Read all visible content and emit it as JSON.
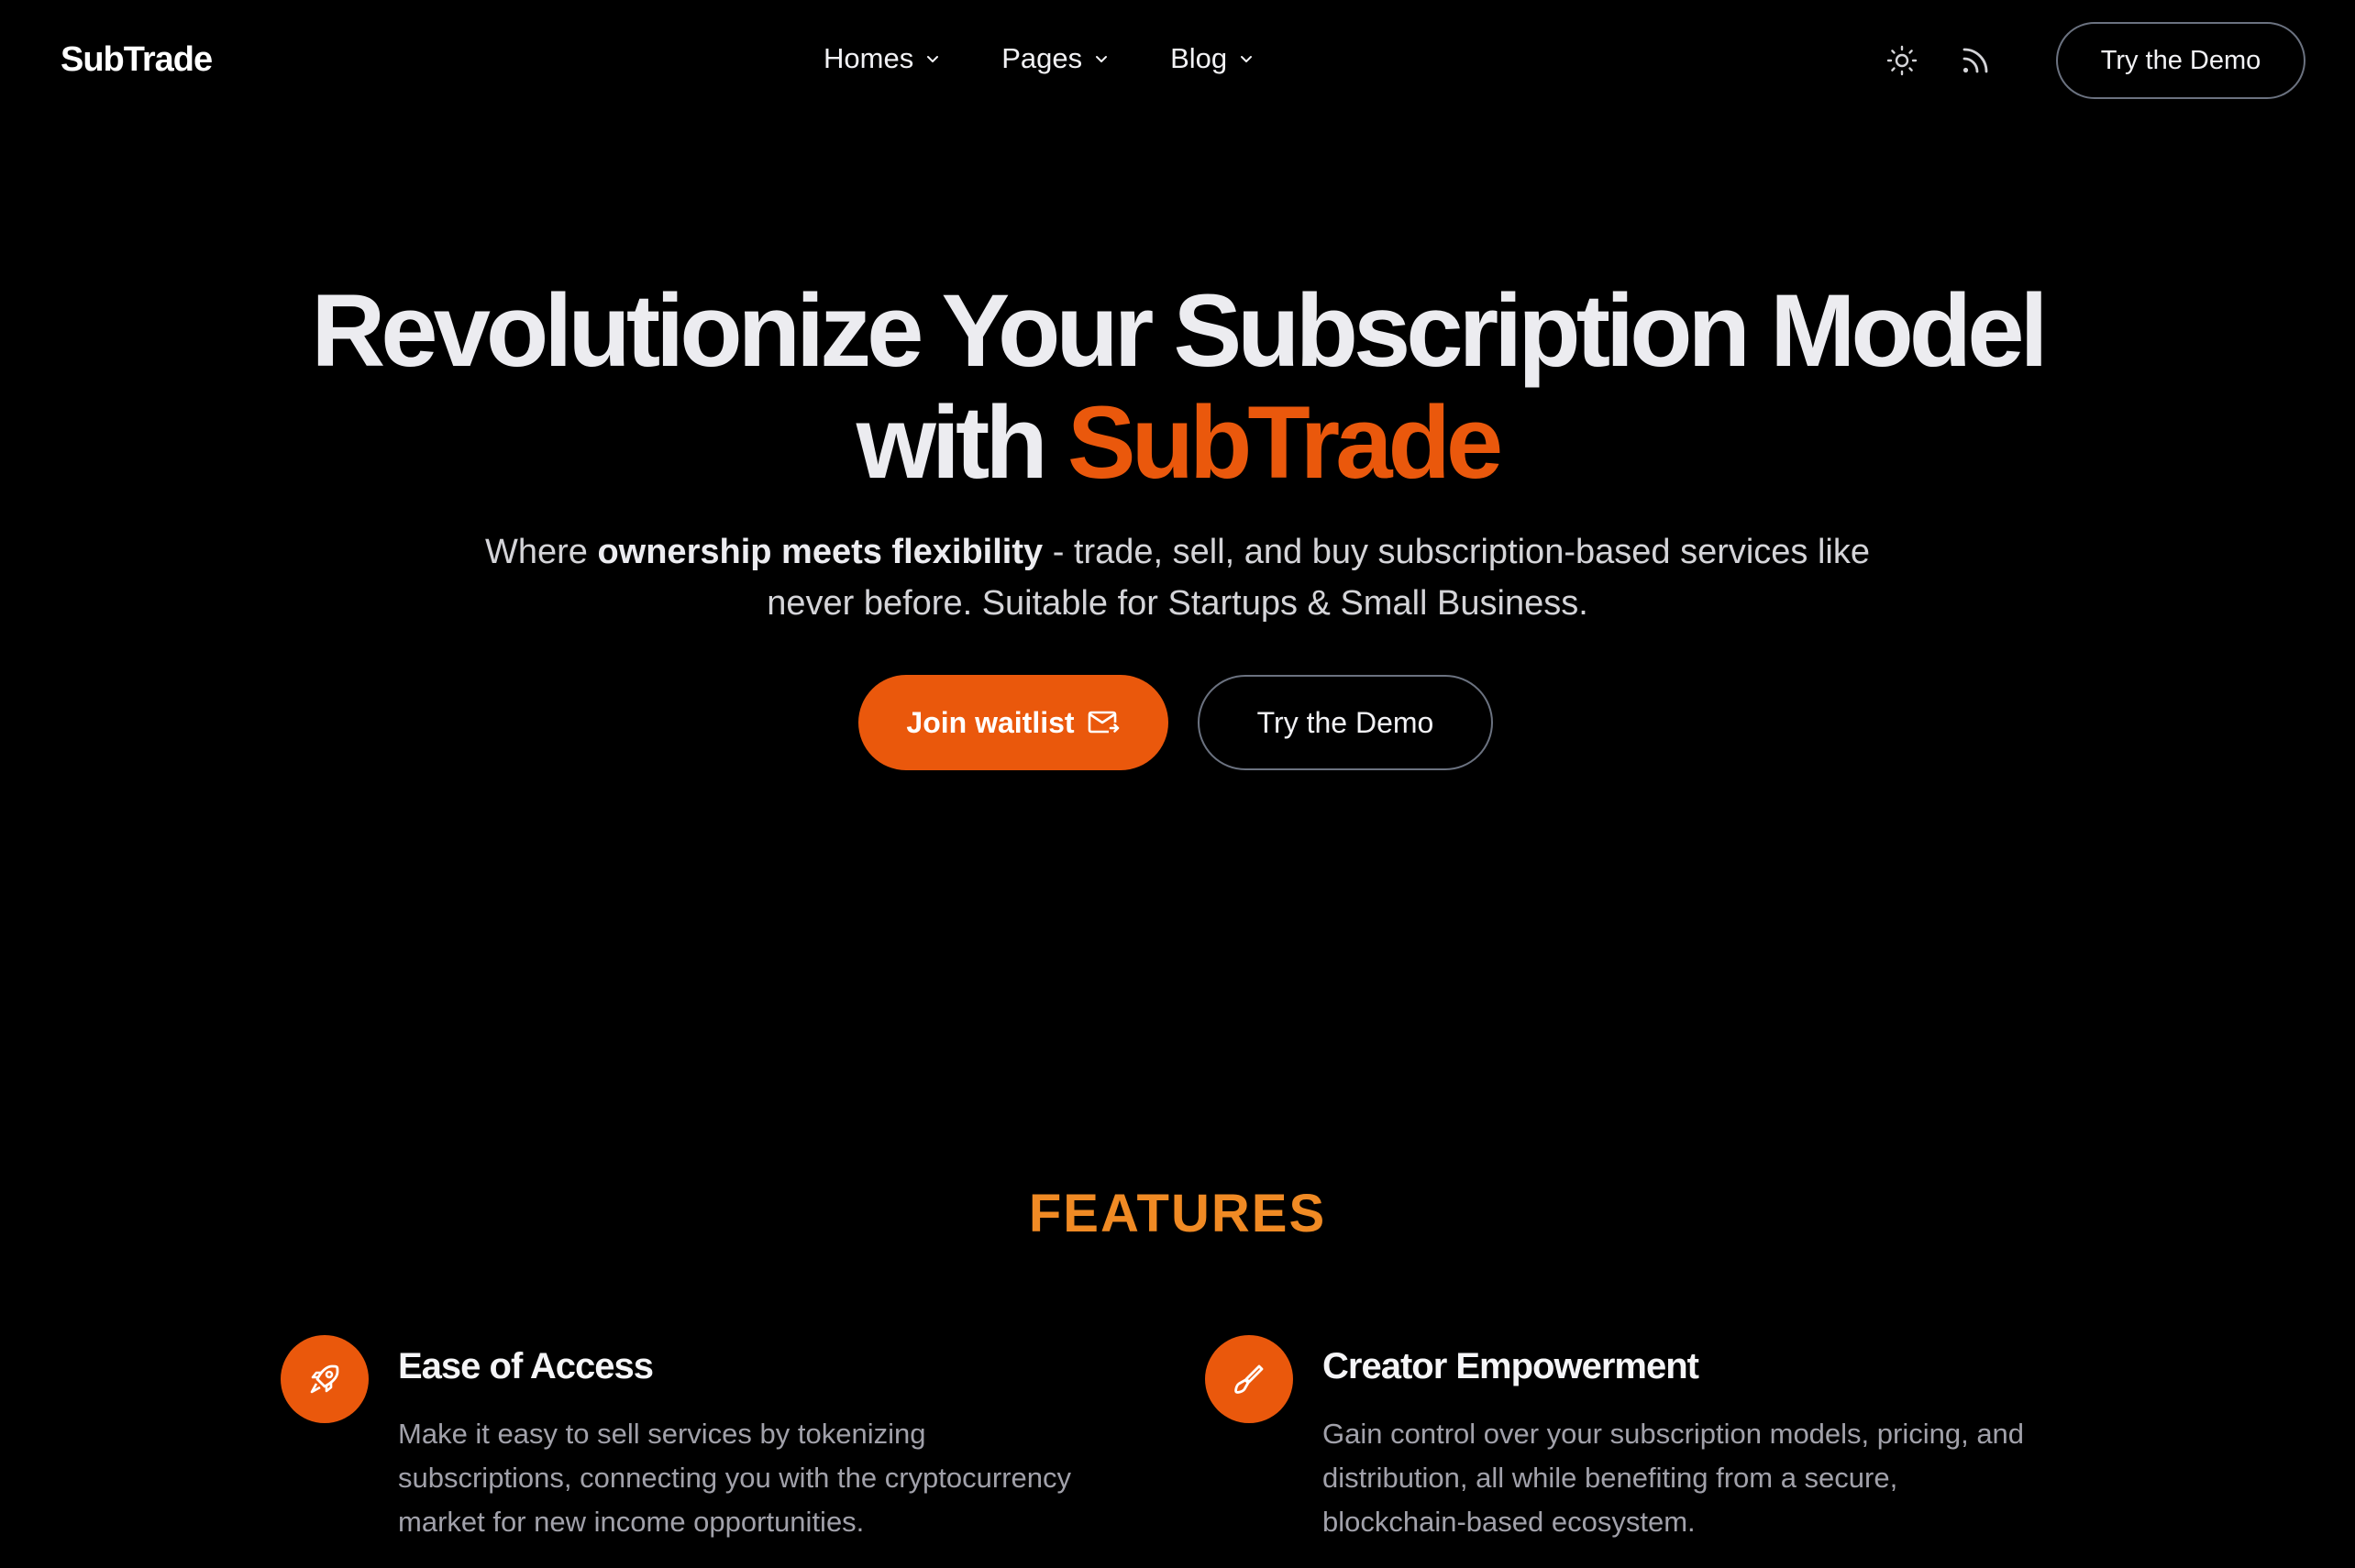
{
  "nav": {
    "logo": "SubTrade",
    "menu": [
      {
        "label": "Homes"
      },
      {
        "label": "Pages"
      },
      {
        "label": "Blog"
      }
    ],
    "icons": [
      "sun-icon",
      "rss-icon"
    ],
    "cta_label": "Try the Demo"
  },
  "hero": {
    "title_line1": "Revolutionize Your Subscription Model",
    "title_line2_prefix": "with ",
    "title_line2_accent": "SubTrade",
    "subtitle_prefix": "Where ",
    "subtitle_bold": "ownership meets flexibility",
    "subtitle_rest": " - trade, sell, and buy subscription-based services like never before. Suitable for Startups & Small Business.",
    "primary_button": "Join waitlist",
    "primary_button_icon": "mail-send-icon",
    "secondary_button": "Try the Demo"
  },
  "features": {
    "heading": "FEATURES",
    "items": [
      {
        "icon": "rocket-icon",
        "title": "Ease of Access",
        "description": "Make it easy to sell services by tokenizing subscriptions, connecting you with the cryptocurrency market for new income opportunities."
      },
      {
        "icon": "brush-icon",
        "title": "Creator Empowerment",
        "description": "Gain control over your subscription models, pricing, and distribution, all while benefiting from a secure, blockchain-based ecosystem."
      }
    ]
  },
  "colors": {
    "background": "#000000",
    "accent": "#ea580c",
    "features_heading": "#f08a24",
    "button_border": "#6b7280"
  }
}
